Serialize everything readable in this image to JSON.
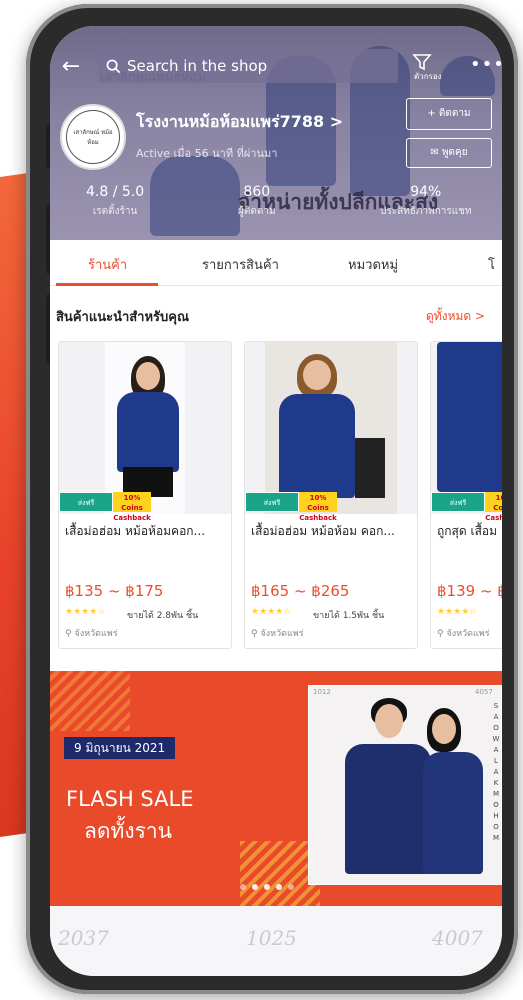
{
  "search": {
    "placeholder": "Search in the shop"
  },
  "header": {
    "filter_label": "ตัวกรอง",
    "more_label": "•••",
    "watermark_top": "เสาลักษณ์หม้อห้อม",
    "watermark": "จำหน่ายทั้งปลีกและส่ง"
  },
  "shop": {
    "avatar_text": "เสาลักษณ์ หม้อห้อม",
    "name": "โรงงานหม้อห้อมแพร่7788",
    "active": "Active เมื่อ 56 นาที ที่ผ่านมา",
    "follow_label": "+ ติดตาม",
    "chat_label": "พูดคุย",
    "stats": [
      {
        "value": "4.8 / 5.0",
        "label": "เรตติ้งร้าน"
      },
      {
        "value": "860",
        "label": "ผู้ติดตาม"
      },
      {
        "value": "94%",
        "label": "ประสิทธิภาพการแชท"
      }
    ]
  },
  "tabs": [
    {
      "label": "ร้านค้า",
      "active": true
    },
    {
      "label": "รายการสินค้า",
      "active": false
    },
    {
      "label": "หมวดหมู่",
      "active": false
    },
    {
      "label": "โ",
      "active": false
    }
  ],
  "recommended": {
    "title": "สินค้าแนะนำสำหรับคุณ",
    "see_all": "ดูทั้งหมด >",
    "badges": {
      "free_ship": "ส่งฟรี",
      "cashback": "10% Coins Cashback"
    },
    "products": [
      {
        "name": "เสื้อม่อฮ่อม หม้อห้อมคอก...",
        "price": "฿135 ~ ฿175",
        "stars": "★★★★☆",
        "sold": "ขายได้ 2.8พัน ชิ้น",
        "location": "จังหวัดแพร่"
      },
      {
        "name": "เสื้อม่อฮ่อม หม้อห้อม คอก...",
        "price": "฿165 ~ ฿265",
        "stars": "★★★★☆",
        "sold": "ขายได้ 1.5พัน ชิ้น",
        "location": "จังหวัดแพร่"
      },
      {
        "name": "ถูกสุด เสื้อม",
        "price": "฿139 ~ ฿",
        "stars": "★★★★☆",
        "sold": "",
        "location": "จังหวัดแพร่"
      }
    ]
  },
  "banner": {
    "date": "9 มิถุนายน 2021",
    "line1": "FLASH SALE",
    "line2": "ลดทั้งราน",
    "photo_code_left": "1012",
    "photo_code_right": "4057",
    "side_text": "SAOWALAKMOHOM"
  },
  "bottom_numbers": [
    "2037",
    "1025",
    "4007"
  ],
  "colors": {
    "accent": "#ee4d2d",
    "banner": "#e84a2a",
    "navy": "#1e2a6a"
  }
}
